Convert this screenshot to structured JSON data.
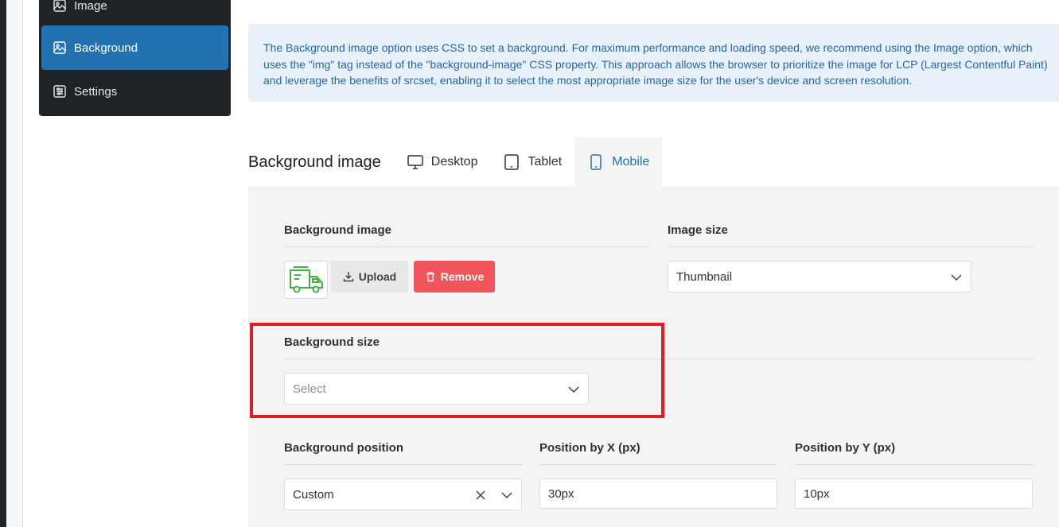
{
  "sidebar": {
    "items": [
      {
        "label": "Image",
        "icon": "image-icon"
      },
      {
        "label": "Background",
        "icon": "background-icon",
        "active": true
      },
      {
        "label": "Settings",
        "icon": "settings-icon"
      }
    ]
  },
  "notice": {
    "text": "The Background image option uses CSS to set a background. For maximum performance and loading speed, we recommend using the Image option, which uses the \"img\" tag instead of the \"background-image\" CSS property. This approach allows the browser to prioritize the image for LCP (Largest Contentful Paint) and leverage the benefits of srcset, enabling it to select the most appropriate image size for the user's device and screen resolution."
  },
  "tabs": {
    "title": "Background image",
    "items": [
      {
        "label": "Desktop",
        "icon": "desktop-icon"
      },
      {
        "label": "Tablet",
        "icon": "tablet-icon"
      },
      {
        "label": "Mobile",
        "icon": "mobile-icon",
        "active": true
      }
    ]
  },
  "form": {
    "background_image": {
      "label": "Background image",
      "upload_label": "Upload",
      "remove_label": "Remove",
      "thumbnail_icon": "delivery-truck-icon"
    },
    "image_size": {
      "label": "Image size",
      "value": "Thumbnail"
    },
    "background_size": {
      "label": "Background size",
      "placeholder": "Select"
    },
    "background_position": {
      "label": "Background position",
      "value": "Custom"
    },
    "position_x": {
      "label": "Position by X (px)",
      "value": "30px"
    },
    "position_y": {
      "label": "Position by Y (px)",
      "value": "10px"
    }
  },
  "colors": {
    "accent": "#2271b1",
    "remove": "#f2545b",
    "highlight": "#e11d2a",
    "truck": "#3fb13f"
  }
}
